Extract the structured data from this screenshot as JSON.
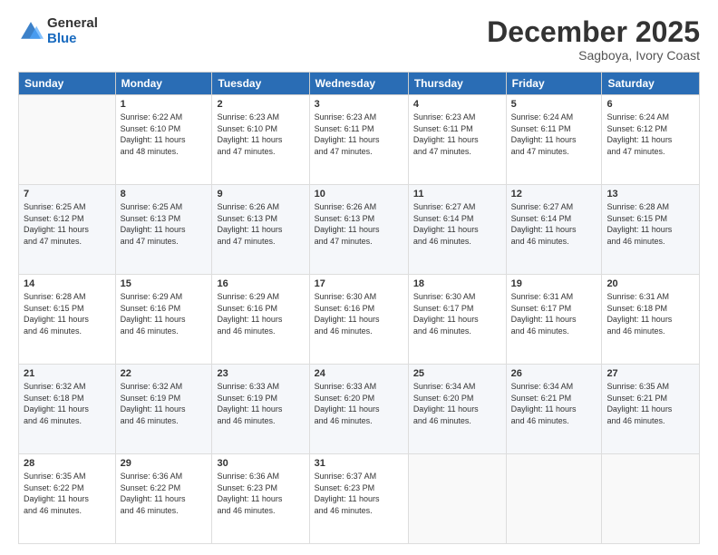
{
  "logo": {
    "general": "General",
    "blue": "Blue"
  },
  "title": "December 2025",
  "subtitle": "Sagboya, Ivory Coast",
  "days_of_week": [
    "Sunday",
    "Monday",
    "Tuesday",
    "Wednesday",
    "Thursday",
    "Friday",
    "Saturday"
  ],
  "weeks": [
    [
      {
        "day": "",
        "info": ""
      },
      {
        "day": "1",
        "info": "Sunrise: 6:22 AM\nSunset: 6:10 PM\nDaylight: 11 hours\nand 48 minutes."
      },
      {
        "day": "2",
        "info": "Sunrise: 6:23 AM\nSunset: 6:10 PM\nDaylight: 11 hours\nand 47 minutes."
      },
      {
        "day": "3",
        "info": "Sunrise: 6:23 AM\nSunset: 6:11 PM\nDaylight: 11 hours\nand 47 minutes."
      },
      {
        "day": "4",
        "info": "Sunrise: 6:23 AM\nSunset: 6:11 PM\nDaylight: 11 hours\nand 47 minutes."
      },
      {
        "day": "5",
        "info": "Sunrise: 6:24 AM\nSunset: 6:11 PM\nDaylight: 11 hours\nand 47 minutes."
      },
      {
        "day": "6",
        "info": "Sunrise: 6:24 AM\nSunset: 6:12 PM\nDaylight: 11 hours\nand 47 minutes."
      }
    ],
    [
      {
        "day": "7",
        "info": "Sunrise: 6:25 AM\nSunset: 6:12 PM\nDaylight: 11 hours\nand 47 minutes."
      },
      {
        "day": "8",
        "info": "Sunrise: 6:25 AM\nSunset: 6:13 PM\nDaylight: 11 hours\nand 47 minutes."
      },
      {
        "day": "9",
        "info": "Sunrise: 6:26 AM\nSunset: 6:13 PM\nDaylight: 11 hours\nand 47 minutes."
      },
      {
        "day": "10",
        "info": "Sunrise: 6:26 AM\nSunset: 6:13 PM\nDaylight: 11 hours\nand 47 minutes."
      },
      {
        "day": "11",
        "info": "Sunrise: 6:27 AM\nSunset: 6:14 PM\nDaylight: 11 hours\nand 46 minutes."
      },
      {
        "day": "12",
        "info": "Sunrise: 6:27 AM\nSunset: 6:14 PM\nDaylight: 11 hours\nand 46 minutes."
      },
      {
        "day": "13",
        "info": "Sunrise: 6:28 AM\nSunset: 6:15 PM\nDaylight: 11 hours\nand 46 minutes."
      }
    ],
    [
      {
        "day": "14",
        "info": "Sunrise: 6:28 AM\nSunset: 6:15 PM\nDaylight: 11 hours\nand 46 minutes."
      },
      {
        "day": "15",
        "info": "Sunrise: 6:29 AM\nSunset: 6:16 PM\nDaylight: 11 hours\nand 46 minutes."
      },
      {
        "day": "16",
        "info": "Sunrise: 6:29 AM\nSunset: 6:16 PM\nDaylight: 11 hours\nand 46 minutes."
      },
      {
        "day": "17",
        "info": "Sunrise: 6:30 AM\nSunset: 6:16 PM\nDaylight: 11 hours\nand 46 minutes."
      },
      {
        "day": "18",
        "info": "Sunrise: 6:30 AM\nSunset: 6:17 PM\nDaylight: 11 hours\nand 46 minutes."
      },
      {
        "day": "19",
        "info": "Sunrise: 6:31 AM\nSunset: 6:17 PM\nDaylight: 11 hours\nand 46 minutes."
      },
      {
        "day": "20",
        "info": "Sunrise: 6:31 AM\nSunset: 6:18 PM\nDaylight: 11 hours\nand 46 minutes."
      }
    ],
    [
      {
        "day": "21",
        "info": "Sunrise: 6:32 AM\nSunset: 6:18 PM\nDaylight: 11 hours\nand 46 minutes."
      },
      {
        "day": "22",
        "info": "Sunrise: 6:32 AM\nSunset: 6:19 PM\nDaylight: 11 hours\nand 46 minutes."
      },
      {
        "day": "23",
        "info": "Sunrise: 6:33 AM\nSunset: 6:19 PM\nDaylight: 11 hours\nand 46 minutes."
      },
      {
        "day": "24",
        "info": "Sunrise: 6:33 AM\nSunset: 6:20 PM\nDaylight: 11 hours\nand 46 minutes."
      },
      {
        "day": "25",
        "info": "Sunrise: 6:34 AM\nSunset: 6:20 PM\nDaylight: 11 hours\nand 46 minutes."
      },
      {
        "day": "26",
        "info": "Sunrise: 6:34 AM\nSunset: 6:21 PM\nDaylight: 11 hours\nand 46 minutes."
      },
      {
        "day": "27",
        "info": "Sunrise: 6:35 AM\nSunset: 6:21 PM\nDaylight: 11 hours\nand 46 minutes."
      }
    ],
    [
      {
        "day": "28",
        "info": "Sunrise: 6:35 AM\nSunset: 6:22 PM\nDaylight: 11 hours\nand 46 minutes."
      },
      {
        "day": "29",
        "info": "Sunrise: 6:36 AM\nSunset: 6:22 PM\nDaylight: 11 hours\nand 46 minutes."
      },
      {
        "day": "30",
        "info": "Sunrise: 6:36 AM\nSunset: 6:23 PM\nDaylight: 11 hours\nand 46 minutes."
      },
      {
        "day": "31",
        "info": "Sunrise: 6:37 AM\nSunset: 6:23 PM\nDaylight: 11 hours\nand 46 minutes."
      },
      {
        "day": "",
        "info": ""
      },
      {
        "day": "",
        "info": ""
      },
      {
        "day": "",
        "info": ""
      }
    ]
  ]
}
